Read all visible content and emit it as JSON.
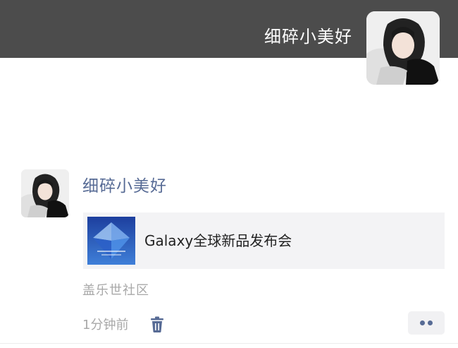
{
  "profile": {
    "name": "细碎小美好",
    "avatar_icon": "user-avatar-photo",
    "cover_color": "#4c4c4c"
  },
  "post": {
    "author": "细碎小美好",
    "author_color": "#576b95",
    "link": {
      "title": "Galaxy全球新品发布会",
      "thumbnail_icon": "galaxy-event-thumbnail"
    },
    "source": "盖乐世社区",
    "time": "1分钟前",
    "delete_icon": "trash-icon",
    "more_icon": "two-dots-icon"
  }
}
